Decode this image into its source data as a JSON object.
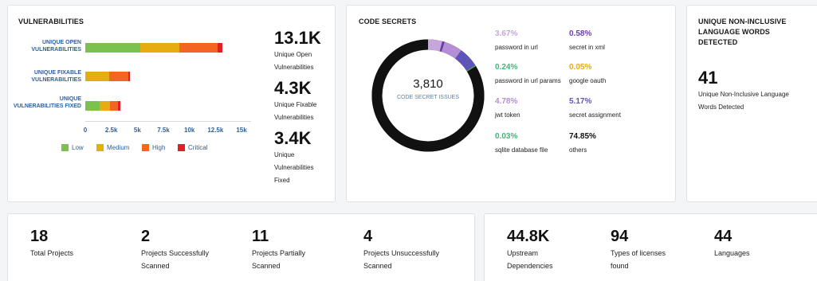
{
  "vulnerabilities": {
    "title": "VULNERABILITIES",
    "rows": [
      {
        "label": "UNIQUE OPEN VULNERABILITIES",
        "low": 5300,
        "medium": 3700,
        "high": 3700,
        "critical": 450
      },
      {
        "label": "UNIQUE FIXABLE VULNERABILITIES",
        "low": 0,
        "medium": 2300,
        "high": 1800,
        "critical": 200
      },
      {
        "label": "UNIQUE VULNERABILITIES FIXED",
        "low": 1400,
        "medium": 1000,
        "high": 700,
        "critical": 300
      }
    ],
    "ticks": [
      "0",
      "2.5k",
      "5k",
      "7.5k",
      "10k",
      "12.5k",
      "15k"
    ],
    "xmax": 15000,
    "legend": [
      {
        "label": "Low",
        "color": "#7cc04f"
      },
      {
        "label": "Medium",
        "color": "#e6ad12"
      },
      {
        "label": "High",
        "color": "#f26522"
      },
      {
        "label": "Critical",
        "color": "#e21f26"
      }
    ],
    "stats": [
      {
        "value": "13.1K",
        "label_lines": [
          "Unique Open",
          "Vulnerabilities"
        ]
      },
      {
        "value": "4.3K",
        "label_lines": [
          "Unique Fixable",
          "Vulnerabilities"
        ]
      },
      {
        "value": "3.4K",
        "label_lines": [
          "Unique",
          "Vulnerabilities",
          "Fixed"
        ]
      }
    ]
  },
  "code_secrets": {
    "title": "CODE SECRETS",
    "total": "3,810",
    "center_label": "CODE SECRET ISSUES",
    "items": [
      {
        "pct": "3.67%",
        "value": 3.67,
        "name": "password in url",
        "color": "#c7a6dc"
      },
      {
        "pct": "0.58%",
        "value": 0.58,
        "name": "secret in xml",
        "color": "#6c3fb0"
      },
      {
        "pct": "0.24%",
        "value": 0.24,
        "name": "password in url params",
        "color": "#47b37a"
      },
      {
        "pct": "0.05%",
        "value": 0.05,
        "name": "google oauth",
        "color": "#e6ad12"
      },
      {
        "pct": "4.78%",
        "value": 4.78,
        "name": "jwt token",
        "color": "#b48ed6"
      },
      {
        "pct": "5.17%",
        "value": 5.17,
        "name": "secret assignment",
        "color": "#5e55b8"
      },
      {
        "pct": "0.03%",
        "value": 0.03,
        "name": "sqlite database file",
        "color": "#47b37a"
      },
      {
        "pct": "74.85%",
        "value": 74.85,
        "name": "others",
        "color": "#111111"
      }
    ]
  },
  "non_inclusive": {
    "title_lines": [
      "UNIQUE NON-INCLUSIVE",
      "LANGUAGE WORDS",
      "DETECTED"
    ],
    "value": "41",
    "label_lines": [
      "Unique Non-Inclusive Language",
      "Words Detected"
    ]
  },
  "projects": [
    {
      "value": "18",
      "label_lines": [
        "Total Projects"
      ]
    },
    {
      "value": "2",
      "label_lines": [
        "Projects Successfully",
        "Scanned"
      ]
    },
    {
      "value": "11",
      "label_lines": [
        "Projects Partially",
        "Scanned"
      ]
    },
    {
      "value": "4",
      "label_lines": [
        "Projects Unsuccessfully",
        "Scanned"
      ]
    }
  ],
  "dependencies": [
    {
      "value": "44.8K",
      "label_lines": [
        "Upstream",
        "Dependencies"
      ]
    },
    {
      "value": "94",
      "label_lines": [
        "Types of licenses",
        "found"
      ]
    },
    {
      "value": "44",
      "label_lines": [
        "Languages"
      ]
    }
  ]
}
